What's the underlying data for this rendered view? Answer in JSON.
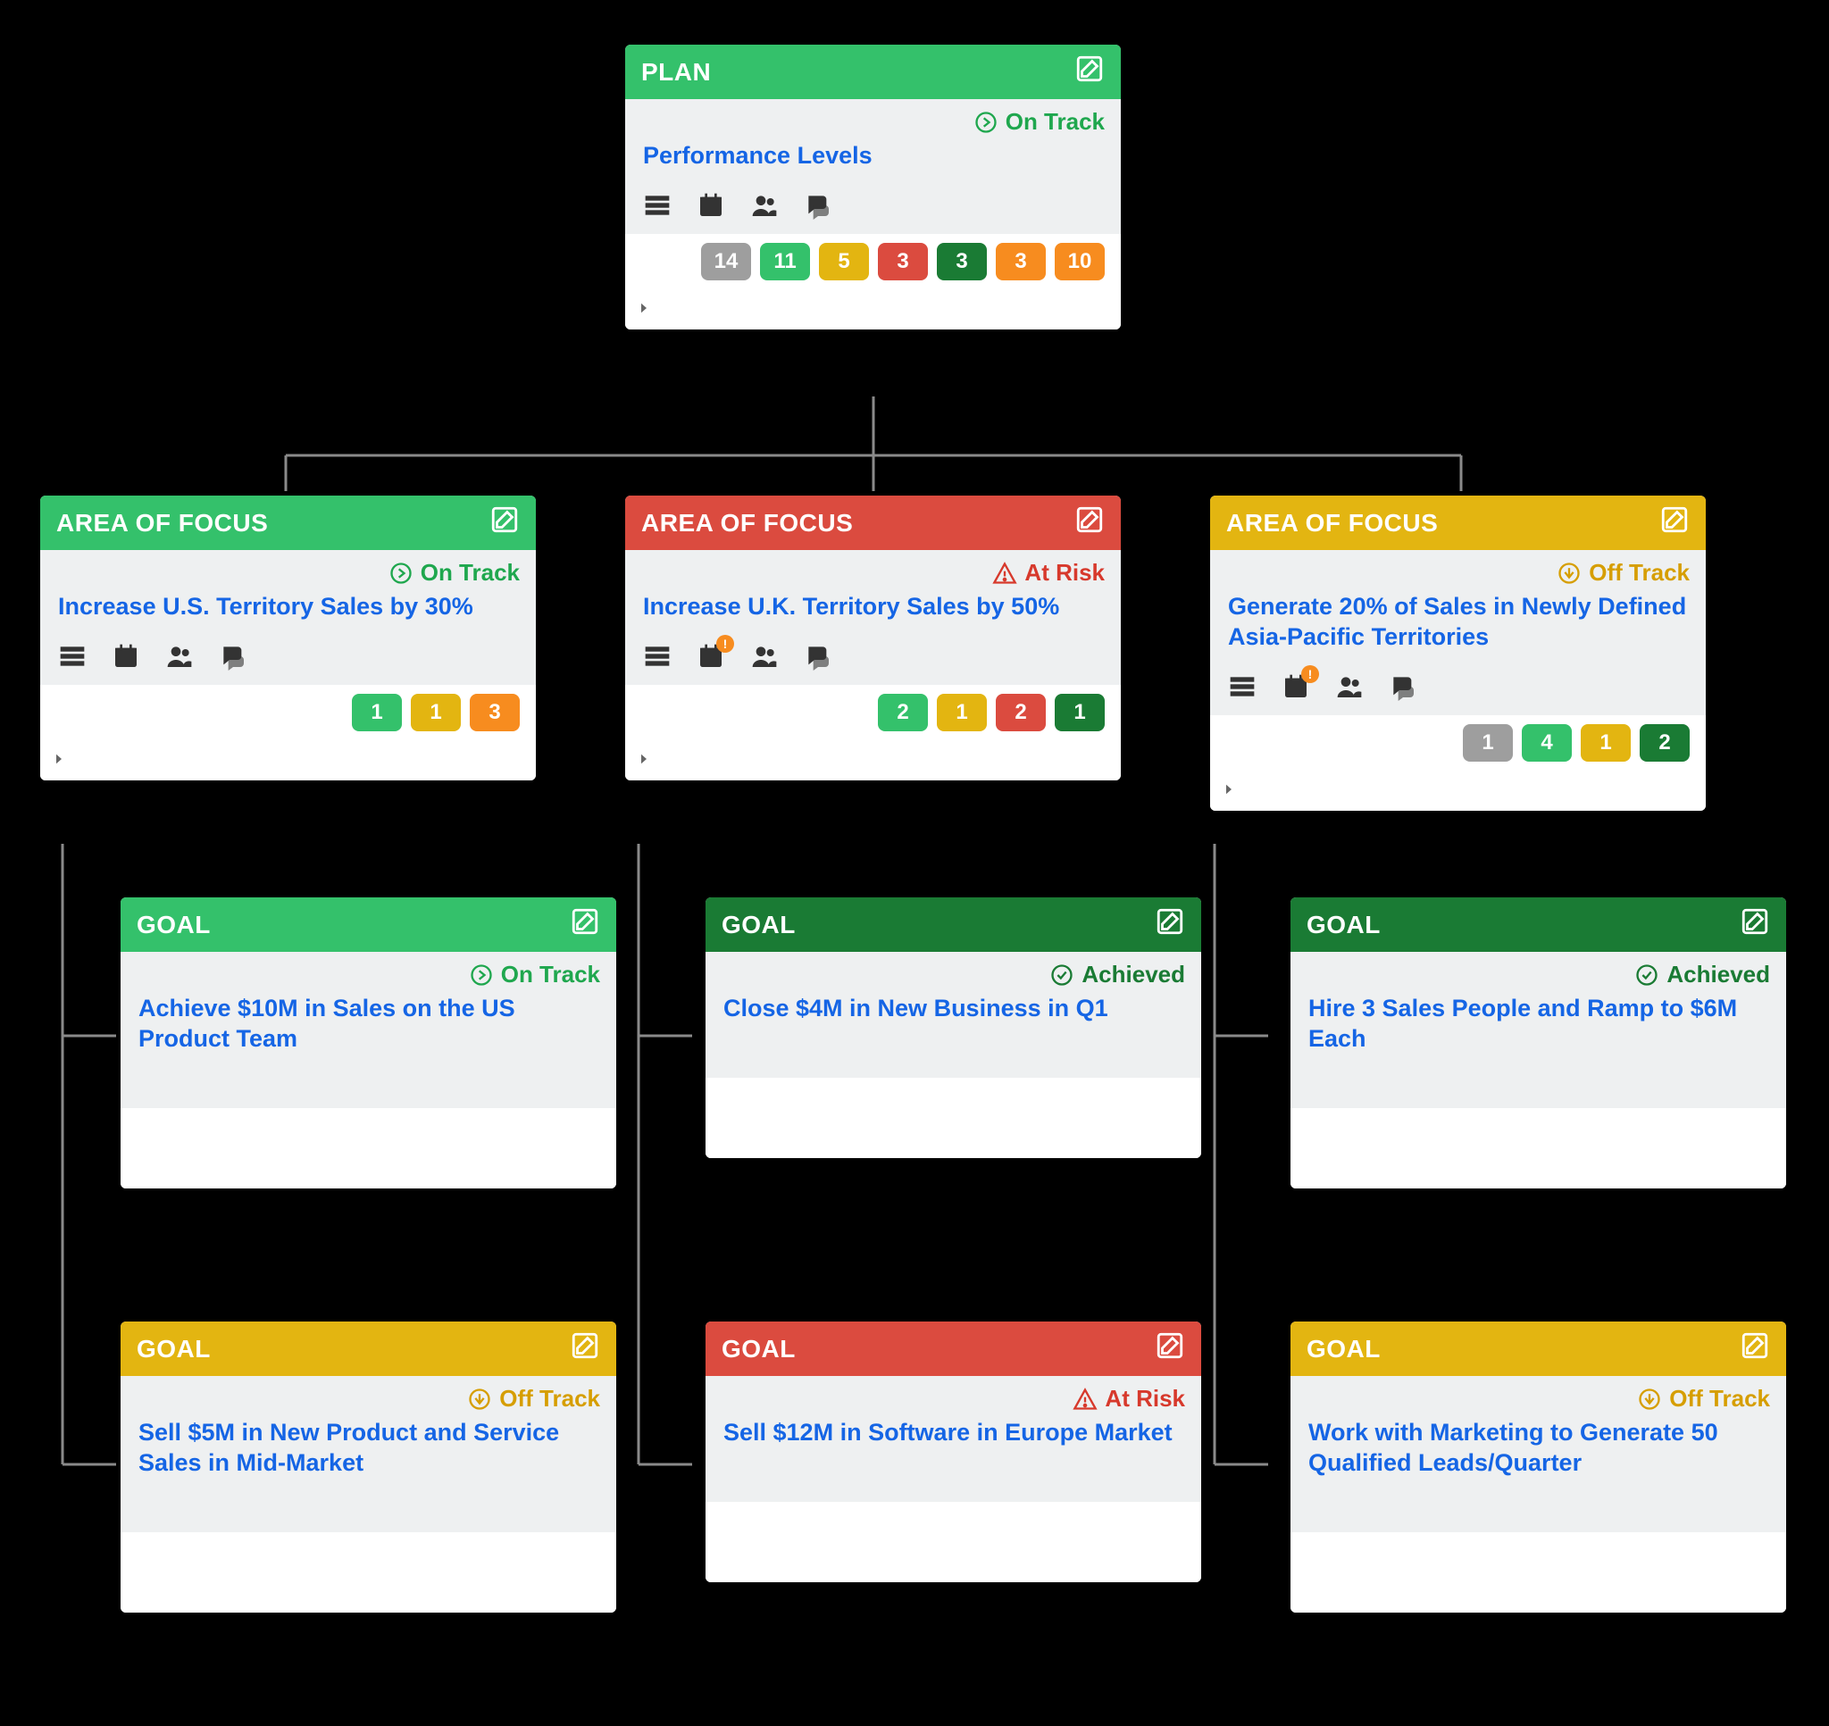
{
  "types": {
    "plan": "PLAN",
    "aof": "AREA OF FOCUS",
    "goal": "GOAL"
  },
  "statuses": {
    "ontrack": {
      "label": "On Track",
      "class": "status-ontrack",
      "icon": "arrow-circle"
    },
    "atrisk": {
      "label": "At Risk",
      "class": "status-atrisk",
      "icon": "warn"
    },
    "offtrack": {
      "label": "Off Track",
      "class": "status-offtrack",
      "icon": "down-circle"
    },
    "achieved": {
      "label": "Achieved",
      "class": "status-achieved",
      "icon": "check-circle"
    }
  },
  "plan": {
    "header": "h-green-light",
    "status": "ontrack",
    "title": "Performance Levels",
    "counts": [
      {
        "c": "gray",
        "v": "14"
      },
      {
        "c": "green",
        "v": "11"
      },
      {
        "c": "yellow",
        "v": "5"
      },
      {
        "c": "red",
        "v": "3"
      },
      {
        "c": "dark-green",
        "v": "3"
      },
      {
        "c": "orange",
        "v": "3"
      },
      {
        "c": "orange",
        "v": "10"
      }
    ]
  },
  "aof": [
    {
      "header": "h-green-light",
      "status": "ontrack",
      "title": "Increase U.S. Territory Sales by 30%",
      "cal_badged": false,
      "counts": [
        {
          "c": "green",
          "v": "1"
        },
        {
          "c": "yellow",
          "v": "1"
        },
        {
          "c": "orange",
          "v": "3"
        }
      ]
    },
    {
      "header": "h-red",
      "status": "atrisk",
      "title": "Increase U.K. Territory Sales by 50%",
      "cal_badged": true,
      "counts": [
        {
          "c": "green",
          "v": "2"
        },
        {
          "c": "yellow",
          "v": "1"
        },
        {
          "c": "red",
          "v": "2"
        },
        {
          "c": "dark-green",
          "v": "1"
        }
      ]
    },
    {
      "header": "h-yellow",
      "status": "offtrack",
      "title": "Generate 20% of Sales in Newly Defined Asia-Pacific Territories",
      "cal_badged": true,
      "counts": [
        {
          "c": "gray",
          "v": "1"
        },
        {
          "c": "green",
          "v": "4"
        },
        {
          "c": "yellow",
          "v": "1"
        },
        {
          "c": "dark-green",
          "v": "2"
        }
      ]
    }
  ],
  "goals": [
    [
      {
        "header": "h-green-light",
        "status": "ontrack",
        "title": "Achieve $10M in Sales on the US Product Team"
      },
      {
        "header": "h-yellow",
        "status": "offtrack",
        "title": "Sell $5M in New Product and Service Sales in Mid-Market"
      }
    ],
    [
      {
        "header": "h-green-dark",
        "status": "achieved",
        "title": "Close $4M in New Business in Q1"
      },
      {
        "header": "h-red",
        "status": "atrisk",
        "title": "Sell $12M in Software in Europe Market"
      }
    ],
    [
      {
        "header": "h-green-dark",
        "status": "achieved",
        "title": "Hire 3 Sales People and Ramp to $6M Each"
      },
      {
        "header": "h-yellow",
        "status": "offtrack",
        "title": "Work with Marketing to Generate 50 Qualified Leads/Quarter"
      }
    ]
  ]
}
